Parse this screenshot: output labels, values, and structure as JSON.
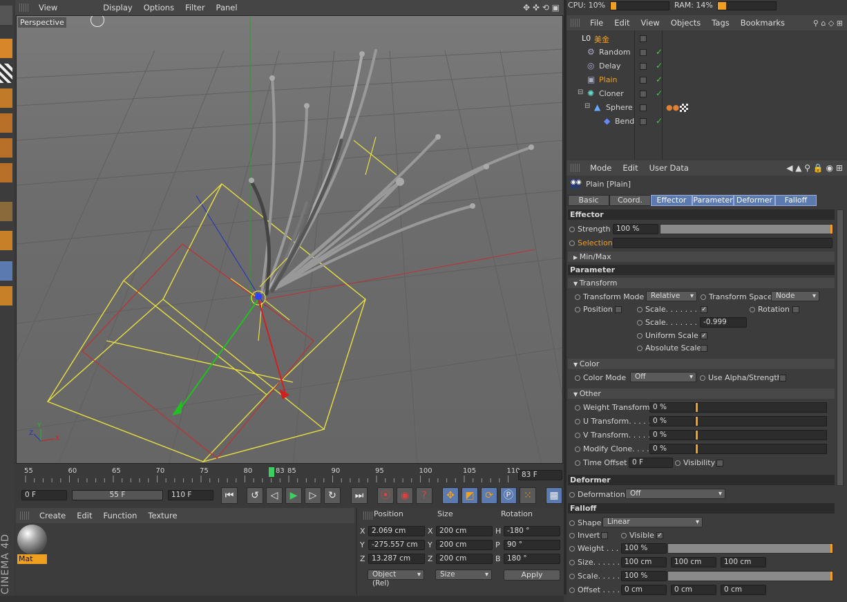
{
  "viewport": {
    "menu": [
      "View",
      "Display",
      "Options",
      "Filter",
      "Panel"
    ],
    "camera_label": "Perspective"
  },
  "status": {
    "cpu": "CPU: 10%",
    "ram": "RAM: 14%",
    "cpu_fraction": 0.1,
    "ram_fraction": 0.14
  },
  "object_manager": {
    "menu": [
      "File",
      "Edit",
      "View",
      "Objects",
      "Tags",
      "Bookmarks"
    ],
    "objects": [
      {
        "name": "美金",
        "selected": false,
        "root": true
      },
      {
        "name": "Random",
        "selected": false
      },
      {
        "name": "Delay",
        "selected": false
      },
      {
        "name": "Plain",
        "selected": true
      },
      {
        "name": "Cloner",
        "selected": false
      },
      {
        "name": "Sphere",
        "selected": false
      },
      {
        "name": "Bend",
        "selected": false
      }
    ]
  },
  "attributes": {
    "menu": [
      "Mode",
      "Edit",
      "User Data"
    ],
    "object_title": "Plain [Plain]",
    "tabs": [
      "Basic",
      "Coord.",
      "Effector",
      "Parameter",
      "Deformer",
      "Falloff"
    ],
    "active_tabs": [
      "Effector",
      "Parameter",
      "Deformer",
      "Falloff"
    ],
    "effector": {
      "header": "Effector",
      "strength_label": "Strength",
      "strength_value": "100 %",
      "selection_label": "Selection",
      "minmax_label": "Min/Max"
    },
    "parameter": {
      "header": "Parameter",
      "transform_header": "Transform",
      "transform_mode_label": "Transform Mode",
      "transform_mode_value": "Relative",
      "transform_space_label": "Transform Space",
      "transform_space_value": "Node",
      "position_label": "Position",
      "scale_label": "Scale. . . . . . . .",
      "rotation_label": "Rotation",
      "scale2_label": "Scale. . . . . . . .",
      "scale2_value": "-0.999",
      "uniform_scale_label": "Uniform Scale",
      "absolute_scale_label": "Absolute Scale",
      "color_header": "Color",
      "color_mode_label": "Color Mode",
      "color_mode_value": "Off",
      "use_alpha_label": "Use Alpha/Strength",
      "other_header": "Other",
      "weight_transform_label": "Weight Transform",
      "weight_transform_value": "0 %",
      "u_transform_label": "U Transform. . . . .",
      "u_transform_value": "0 %",
      "v_transform_label": "V Transform. . . . .",
      "v_transform_value": "0 %",
      "modify_clone_label": "Modify Clone. . . .",
      "modify_clone_value": "0 %",
      "time_offset_label": "Time Offset",
      "time_offset_value": "0 F",
      "visibility_label": "Visibility"
    },
    "deformer": {
      "header": "Deformer",
      "deformation_label": "Deformation",
      "deformation_value": "Off"
    },
    "falloff": {
      "header": "Falloff",
      "shape_label": "Shape",
      "shape_value": "Linear",
      "invert_label": "Invert",
      "visible_label": "Visible",
      "weight_label": "Weight . . .",
      "weight_value": "100 %",
      "size_label": "Size. . . . . .",
      "size_values": [
        "100 cm",
        "100 cm",
        "100 cm"
      ],
      "scale_label": "Scale. . . . .",
      "scale_value": "100 %",
      "offset_label": "Offset . . . .",
      "offset_values": [
        "0 cm",
        "0 cm",
        "0 cm"
      ]
    }
  },
  "timeline": {
    "ticks": [
      "55",
      "60",
      "65",
      "70",
      "75",
      "80",
      "85",
      "90",
      "95",
      "100",
      "105",
      "110"
    ],
    "current_frame_marker": "83",
    "current_frame_field": "83 F",
    "start_field": "0 F",
    "range_field": "55 F",
    "end_field": "110 F"
  },
  "material_manager": {
    "menu": [
      "Create",
      "Edit",
      "Function",
      "Texture"
    ],
    "material_name": "Mat"
  },
  "coordinates": {
    "headers": [
      "Position",
      "Size",
      "Rotation"
    ],
    "rows": [
      {
        "axis": "X",
        "pos": "2.069 cm",
        "size_axis": "X",
        "size": "200 cm",
        "rot_axis": "H",
        "rot": "-180 °"
      },
      {
        "axis": "Y",
        "pos": "-275.557 cm",
        "size_axis": "Y",
        "size": "200 cm",
        "rot_axis": "P",
        "rot": "90 °"
      },
      {
        "axis": "Z",
        "pos": "13.287 cm",
        "size_axis": "Z",
        "size": "200 cm",
        "rot_axis": "B",
        "rot": "180 °"
      }
    ],
    "mode_dropdown": "Object (Rel)",
    "size_dropdown": "Size",
    "apply_label": "Apply"
  },
  "branding": "CINEMA 4D",
  "colors": {
    "accent_orange": "#f0a020",
    "active_tab_blue": "#5a7ab0",
    "selection_yellow": "#e8e040"
  }
}
